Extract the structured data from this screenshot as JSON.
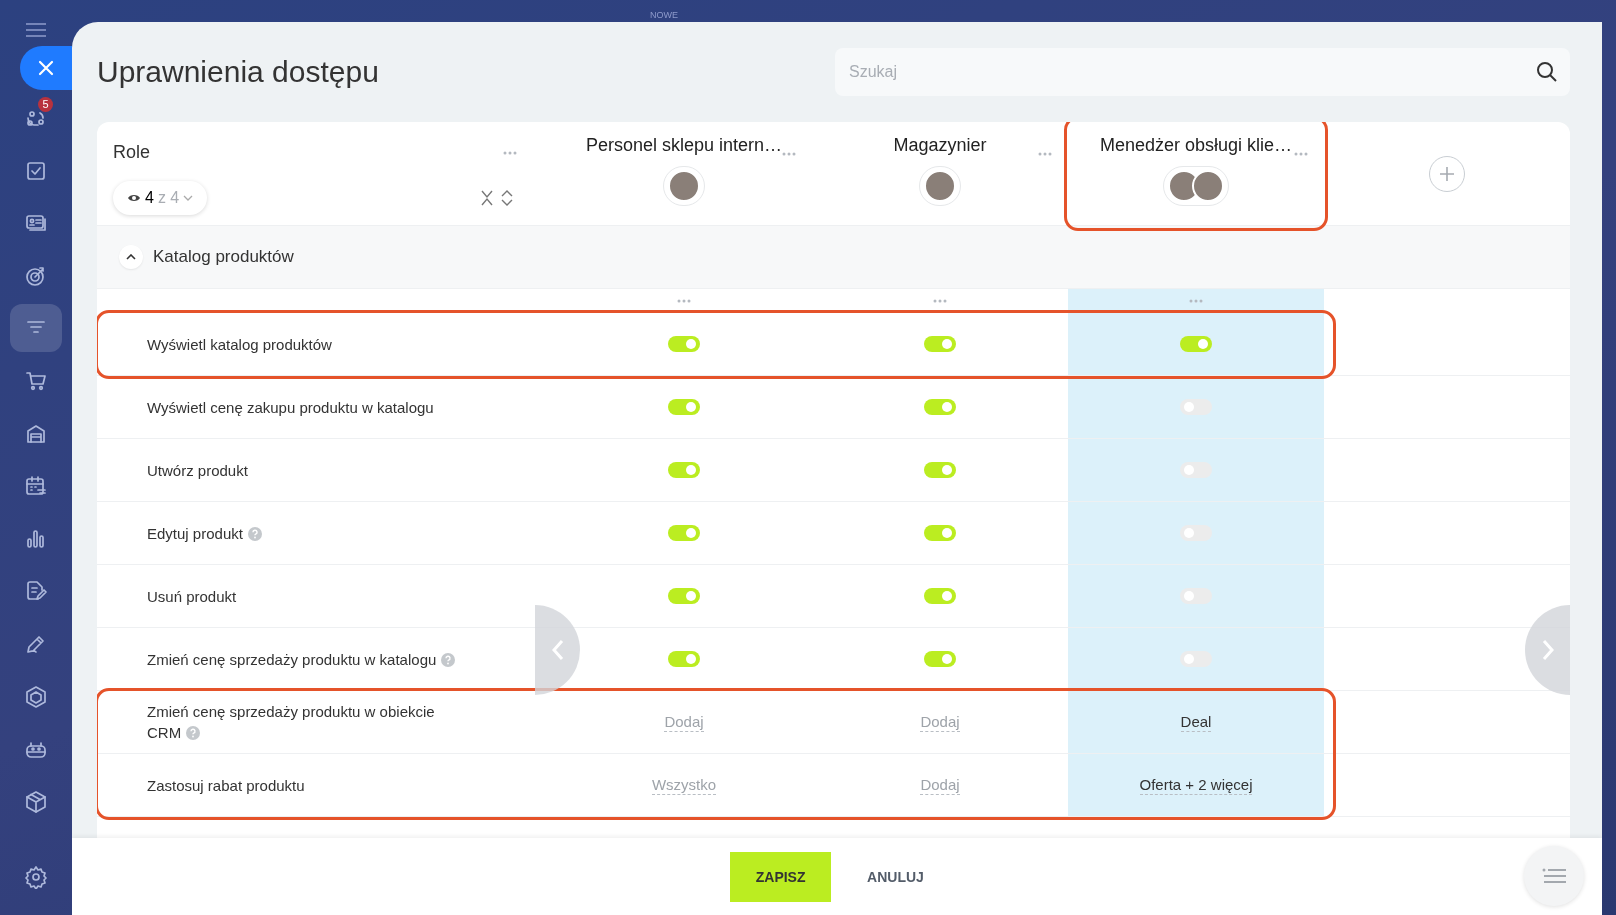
{
  "background_label": "NOWE",
  "sidebar": {
    "items": [
      {
        "selected": false,
        "badge": "5"
      },
      {
        "selected": false
      },
      {
        "selected": false
      },
      {
        "selected": false
      },
      {
        "selected": true
      },
      {
        "selected": false
      },
      {
        "selected": false
      },
      {
        "selected": false
      },
      {
        "selected": false
      },
      {
        "selected": false
      },
      {
        "selected": false
      },
      {
        "selected": false
      },
      {
        "selected": false
      },
      {
        "selected": false
      },
      {
        "selected": false
      }
    ]
  },
  "title": "Uprawnienia dostępu",
  "search": {
    "placeholder": "Szukaj"
  },
  "role_header": {
    "label": "Role",
    "visible_count": "4",
    "total": "z 4"
  },
  "columns": [
    {
      "name": "Personel sklepu intern…",
      "highlighted": false,
      "selected": false,
      "avatars": [
        {
          "kind": "photo"
        }
      ]
    },
    {
      "name": "Magazynier",
      "highlighted": false,
      "selected": false,
      "avatars": [
        {
          "kind": "photo"
        }
      ]
    },
    {
      "name": "Menedżer obsługi klie…",
      "highlighted": true,
      "selected": true,
      "avatars": [
        {
          "kind": "photo"
        },
        {
          "kind": "photo"
        }
      ]
    }
  ],
  "section": {
    "title": "Katalog produktów",
    "expanded": true
  },
  "rows": [
    {
      "label": "Wyświetl katalog produktów",
      "help": false,
      "highlighted": true,
      "cells": [
        {
          "kind": "toggle",
          "on": true
        },
        {
          "kind": "toggle",
          "on": true
        },
        {
          "kind": "toggle",
          "on": true
        }
      ]
    },
    {
      "label": "Wyświetl cenę zakupu produktu w katalogu",
      "help": false,
      "highlighted": false,
      "cells": [
        {
          "kind": "toggle",
          "on": true
        },
        {
          "kind": "toggle",
          "on": true
        },
        {
          "kind": "toggle",
          "on": false
        }
      ]
    },
    {
      "label": "Utwórz produkt",
      "help": false,
      "highlighted": false,
      "cells": [
        {
          "kind": "toggle",
          "on": true
        },
        {
          "kind": "toggle",
          "on": true
        },
        {
          "kind": "toggle",
          "on": false
        }
      ]
    },
    {
      "label": "Edytuj produkt",
      "help": true,
      "highlighted": false,
      "cells": [
        {
          "kind": "toggle",
          "on": true
        },
        {
          "kind": "toggle",
          "on": true
        },
        {
          "kind": "toggle",
          "on": false
        }
      ]
    },
    {
      "label": "Usuń produkt",
      "help": false,
      "highlighted": false,
      "cells": [
        {
          "kind": "toggle",
          "on": true
        },
        {
          "kind": "toggle",
          "on": true
        },
        {
          "kind": "toggle",
          "on": false
        }
      ]
    },
    {
      "label": "Zmień cenę sprzedaży produktu w katalogu",
      "help": true,
      "highlighted": false,
      "cells": [
        {
          "kind": "toggle",
          "on": true
        },
        {
          "kind": "toggle",
          "on": true
        },
        {
          "kind": "toggle",
          "on": false
        }
      ]
    },
    {
      "label": "Zmień cenę sprzedaży produktu w obiekcie CRM",
      "help": true,
      "highlighted": true,
      "cells": [
        {
          "kind": "selector",
          "text": "Dodaj",
          "muted": true
        },
        {
          "kind": "selector",
          "text": "Dodaj",
          "muted": true
        },
        {
          "kind": "selector",
          "text": "Deal",
          "muted": false
        }
      ]
    },
    {
      "label": "Zastosuj rabat produktu",
      "help": false,
      "highlighted": true,
      "cells": [
        {
          "kind": "selector",
          "text": "Wszystko",
          "muted": true
        },
        {
          "kind": "selector",
          "text": "Dodaj",
          "muted": true
        },
        {
          "kind": "selector",
          "text": "Oferta + 2 więcej",
          "muted": false
        }
      ]
    }
  ],
  "footer": {
    "buttons": [
      {
        "label": "ZAPISZ",
        "kind": "primary"
      },
      {
        "label": "ANULUJ",
        "kind": "plain"
      }
    ]
  }
}
